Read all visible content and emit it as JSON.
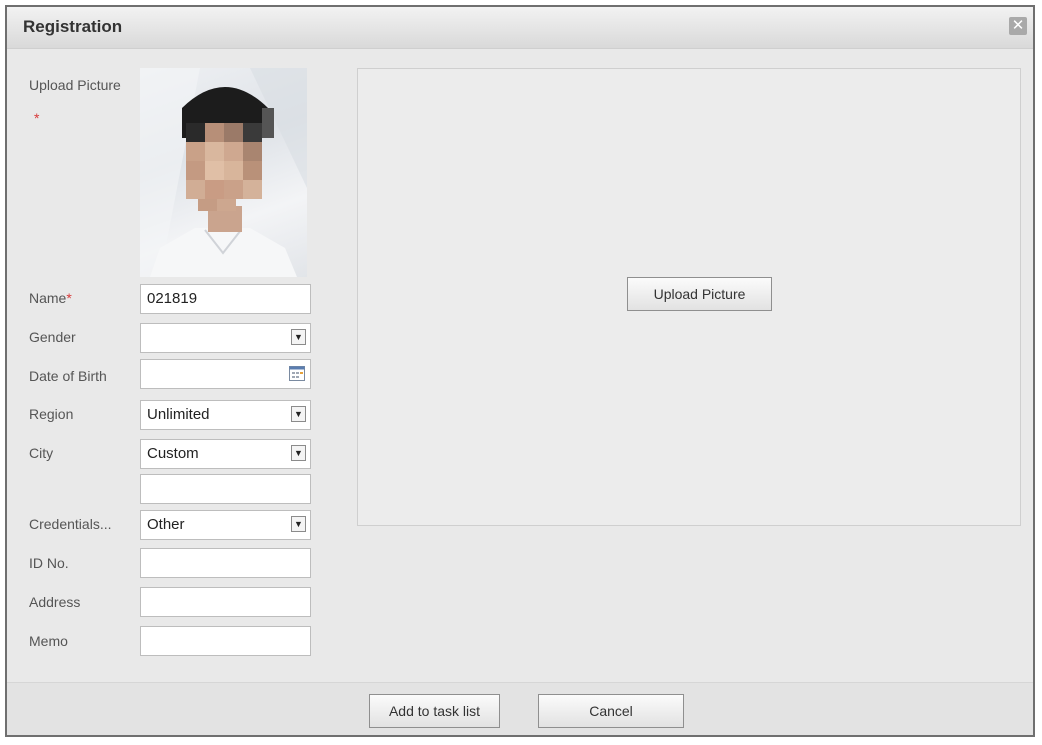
{
  "dialog": {
    "title": "Registration",
    "close_icon": "close-icon"
  },
  "form": {
    "upload_picture_label": "Upload Picture",
    "required_mark": "*",
    "name": {
      "label": "Name",
      "value": "021819"
    },
    "gender": {
      "label": "Gender",
      "value": ""
    },
    "date_of_birth": {
      "label": "Date of Birth",
      "value": ""
    },
    "region": {
      "label": "Region",
      "value": "Unlimited"
    },
    "city": {
      "label": "City",
      "value": "Custom"
    },
    "city_custom": {
      "value": ""
    },
    "credentials": {
      "label": "Credentials...",
      "value": "Other"
    },
    "id_no": {
      "label": "ID No.",
      "value": ""
    },
    "address": {
      "label": "Address",
      "value": ""
    },
    "memo": {
      "label": "Memo",
      "value": ""
    }
  },
  "preview": {
    "upload_button_label": "Upload Picture"
  },
  "footer": {
    "add_label": "Add to task list",
    "cancel_label": "Cancel"
  },
  "colors": {
    "required": "#d83a3a",
    "title_bar": "#e0e0e0",
    "panel": "#ececec"
  }
}
